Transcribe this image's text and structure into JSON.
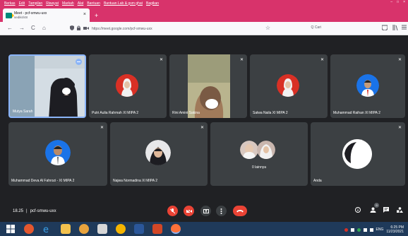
{
  "menubar": {
    "items": [
      "Berkas",
      "Edit",
      "Tampilan",
      "Riwayat",
      "Markah",
      "Alat",
      "Bantuan",
      "Bantuan Lab & gsm ghat",
      "Bagikan"
    ],
    "window_controls": [
      "–",
      "□",
      "×"
    ]
  },
  "tab": {
    "title": "Meet - pcf-smwu-uxx",
    "subtitle": "sedikit/48",
    "close": "×",
    "new_tab": "+"
  },
  "navbar": {
    "back": "←",
    "forward": "→",
    "reload": "C",
    "home": "⌂",
    "url": "https://meet.google.com/pcf-smwu-uxx",
    "search_placeholder": "Q Cari"
  },
  "tiles": [
    {
      "name": "Mutya Sarah",
      "accent": "#8ab4f8"
    },
    {
      "name": "Putri Aulia Rahmah XI MIPA 2",
      "accent": "#d93025"
    },
    {
      "name": "Rini Amini Sakina",
      "accent": "#c8a27a"
    },
    {
      "name": "Salwa Naila XI MIPA 2",
      "accent": "#d93025"
    },
    {
      "name": "Muhammad Raihan XI MIPA 2",
      "accent": "#1a73e8"
    },
    {
      "name": "Muhammad Deva Al Fahrozi - XI MIPA 2",
      "accent": "#1a73e8"
    },
    {
      "name": "Najwa Normadina XI MIPA 2",
      "accent": "#5f6368"
    },
    {
      "name": "0 lainnya",
      "accent": "#5f6368"
    },
    {
      "name": "Anda",
      "accent": "#ffffff"
    }
  ],
  "bottom": {
    "time": "18.25",
    "separator": "|",
    "meeting_code": "pcf-smwu-uxx",
    "participant_count": "9"
  },
  "taskbar": {
    "lang": "ENG",
    "time": "6:25 PM",
    "date": "11/23/2021"
  },
  "colors": {
    "firefox_pink": "#d8336b",
    "meet_bg": "#202124",
    "tile_bg": "#3c4043",
    "end_call": "#ea4335",
    "taskbar": "#1f3a5a"
  }
}
